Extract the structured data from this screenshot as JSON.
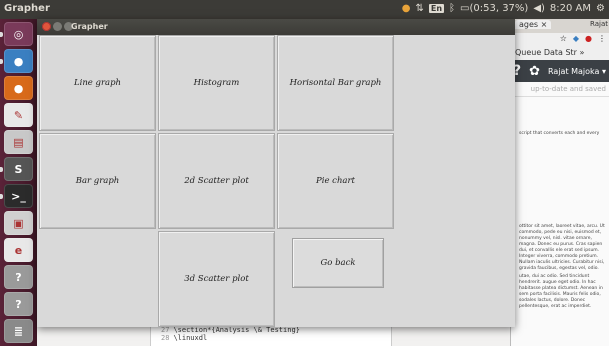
{
  "top_panel": {
    "app_name": "Grapher",
    "battery": "(0:53, 37%)",
    "keyboard": "En",
    "time": "8:20 AM"
  },
  "launcher": {
    "items": [
      {
        "name": "dash-home",
        "color": "#7a3a5a",
        "glyph": "◎"
      },
      {
        "name": "chromium",
        "color": "#3a7fc1",
        "glyph": "●"
      },
      {
        "name": "firefox",
        "color": "#d86a1a",
        "glyph": "●"
      },
      {
        "name": "text-editor",
        "color": "#e8e8e8",
        "glyph": "✎"
      },
      {
        "name": "files",
        "color": "#c8c8c8",
        "glyph": "▤"
      },
      {
        "name": "sublime-text",
        "color": "#555555",
        "glyph": "S"
      },
      {
        "name": "terminal",
        "color": "#2b2b2b",
        "glyph": ">_"
      },
      {
        "name": "screenshot",
        "color": "#d0d0d0",
        "glyph": "▣"
      },
      {
        "name": "app-e",
        "color": "#e8e8e8",
        "glyph": "e"
      },
      {
        "name": "unknown-app-1",
        "color": "#9a9a9a",
        "glyph": "?"
      },
      {
        "name": "unknown-app-2",
        "color": "#9a9a9a",
        "glyph": "?"
      },
      {
        "name": "workspace-switcher",
        "color": "#8a8a8a",
        "glyph": "≣"
      }
    ]
  },
  "grapher": {
    "title": "Grapher",
    "buttons": {
      "line_graph": "Line graph",
      "histogram": "Histogram",
      "horizontal_bar": "Horisontal Bar graph",
      "bar_graph": "Bar graph",
      "scatter_2d": "2d Scatter plot",
      "pie_chart": "Pie chart",
      "scatter_3d": "3d Scatter plot",
      "go_back": "Go back"
    }
  },
  "browser": {
    "tab_label": "ages",
    "tab_close": "×",
    "user_tag": "Rajat",
    "bookmark": "Queue Data Str",
    "bookmark_more": "»",
    "help_glyph": "?",
    "user_name": "Rajat Majoka",
    "saved_status": "up-to-date and saved",
    "text_1": "script that converts each and every",
    "text_2": "ottitor sit amet, laoreet vitae, arcu. Ut commodo, pede eu nisi, euismod et, nonummy vel, nisl. vitae ornare, magna. Donec eu purus. Cras sapien dui, et convallis ele erat sed ipsum. Integer viverra, commodo pretium. Nullam iaculis ultricies. Curabitur nisi, gravida faucibus, egestas vel, odio.",
    "text_3": "utae, dui ac odio. Sed tincidunt hendrerit. augue eget odio. In hac habitasse platea dictumst. Aenean in sem porta facilisis. Mauris felis odio, sodales lactus, dolore. Donec pellentesque, erat ac imperdiet."
  },
  "editor": {
    "line_no_1": "27",
    "line_1": "\\section*{Analysis \\& Testing}",
    "line_no_2": "28",
    "line_2": "\\linuxdl"
  }
}
